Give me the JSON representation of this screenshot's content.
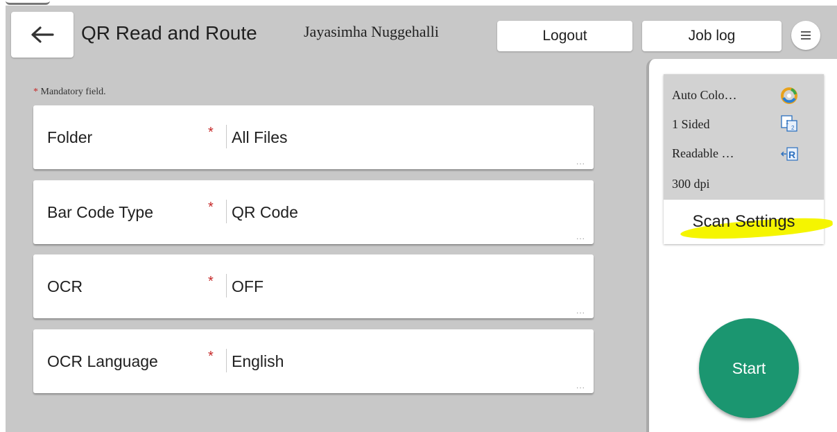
{
  "header": {
    "back_icon": "arrow-left-icon",
    "title": "QR Read and Route",
    "user": "Jayasimha Nuggehalli",
    "logout_label": "Logout",
    "joblog_label": "Job log",
    "menu_icon": "hamburger-menu-icon"
  },
  "form": {
    "mandatory_star": "*",
    "mandatory_note": "Mandatory field.",
    "fields": [
      {
        "label": "Folder",
        "required": "*",
        "value": "All Files",
        "more": "..."
      },
      {
        "label": "Bar Code Type",
        "required": "*",
        "value": "QR Code",
        "more": "..."
      },
      {
        "label": "OCR",
        "required": "*",
        "value": "OFF",
        "more": "..."
      },
      {
        "label": "OCR Language",
        "required": "*",
        "value": "English",
        "more": "..."
      }
    ]
  },
  "scan_settings": {
    "color_mode": "Auto Colo…",
    "color_icon": "color-mode-icon",
    "sides": "1 Sided",
    "sides_icon": "duplex-icon",
    "orientation": "Readable …",
    "orientation_icon": "orientation-icon",
    "resolution": "300 dpi",
    "button_label": "Scan Settings"
  },
  "start_label": "Start",
  "colors": {
    "background": "#c8c8c8",
    "start_button": "#1b9670",
    "required_star": "#c62828",
    "highlight": "#f5f500"
  }
}
